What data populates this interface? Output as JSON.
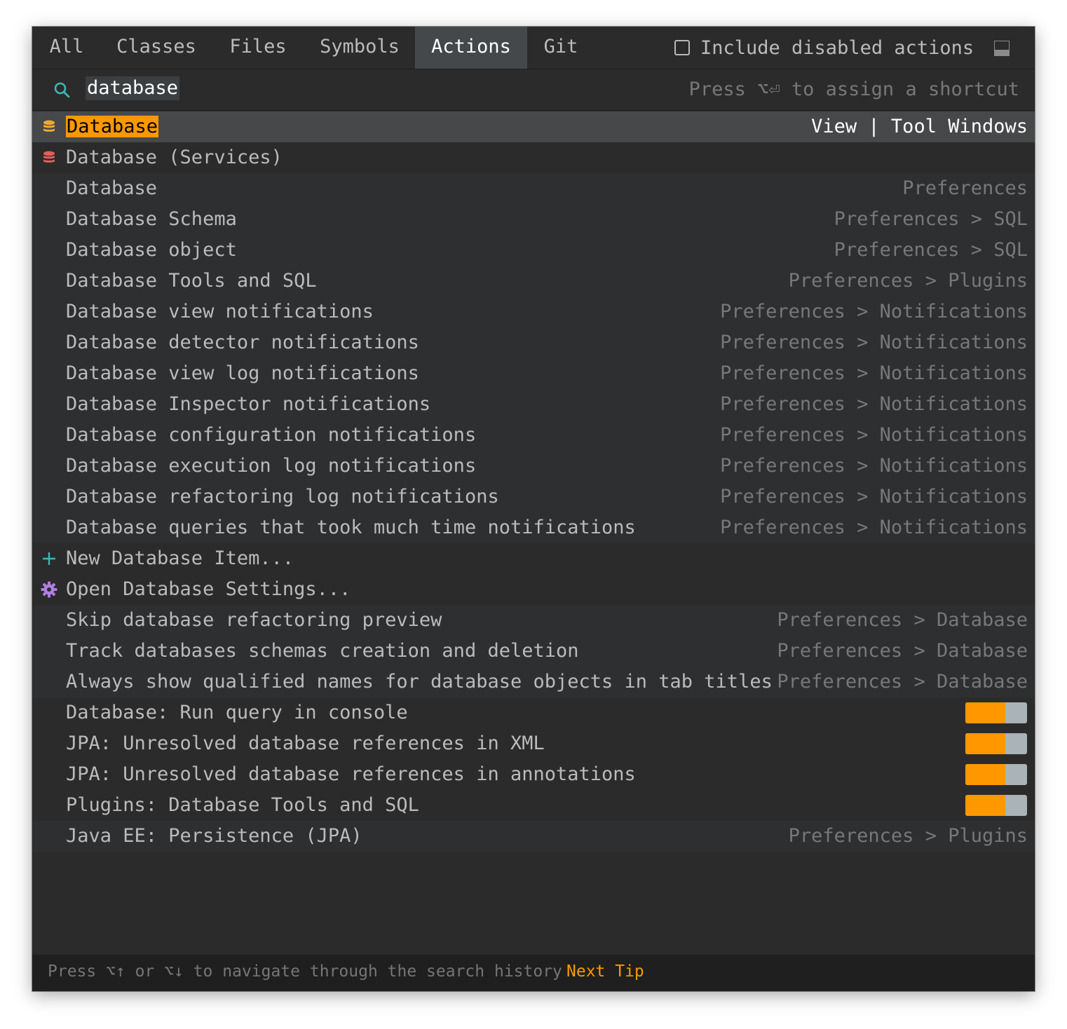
{
  "tabs": [
    {
      "label": "All"
    },
    {
      "label": "Classes"
    },
    {
      "label": "Files"
    },
    {
      "label": "Symbols"
    },
    {
      "label": "Actions",
      "active": true
    },
    {
      "label": "Git"
    }
  ],
  "include_disabled": {
    "label": "Include disabled actions",
    "checked": false
  },
  "search": {
    "value": "database",
    "hint": "Press ⌥⏎ to assign a shortcut"
  },
  "results": {
    "selected": {
      "match": "Database",
      "location": "View | Tool Windows",
      "icon": "database-icon"
    },
    "services": {
      "name": "Database (Services)",
      "icon": "database-services-icon"
    },
    "settings_group": [
      {
        "name": "Database",
        "location": "Preferences"
      },
      {
        "name": "Database Schema",
        "location": "Preferences > SQL"
      },
      {
        "name": "Database object",
        "location": "Preferences > SQL"
      },
      {
        "name": "Database Tools and SQL",
        "location": "Preferences > Plugins"
      },
      {
        "name": "Database view notifications",
        "location": "Preferences > Notifications"
      },
      {
        "name": "Database detector notifications",
        "location": "Preferences > Notifications"
      },
      {
        "name": "Database view log notifications",
        "location": "Preferences > Notifications"
      },
      {
        "name": "Database Inspector notifications",
        "location": "Preferences > Notifications"
      },
      {
        "name": "Database configuration notifications",
        "location": "Preferences > Notifications"
      },
      {
        "name": "Database execution log notifications",
        "location": "Preferences > Notifications"
      },
      {
        "name": "Database refactoring log notifications",
        "location": "Preferences > Notifications"
      },
      {
        "name": "Database queries that took much time notifications",
        "location": "Preferences > Notifications"
      }
    ],
    "actions": [
      {
        "name": "New Database Item...",
        "icon": "plus-icon"
      },
      {
        "name": "Open Database Settings...",
        "icon": "gear-icon"
      }
    ],
    "db_options": [
      {
        "name": "Skip database refactoring preview",
        "location": "Preferences > Database"
      },
      {
        "name": "Track databases schemas creation and deletion",
        "location": "Preferences > Database"
      },
      {
        "name": "Always show qualified names for database objects in tab titles",
        "location": "Preferences > Database"
      }
    ],
    "toggles": [
      {
        "name": "Database: Run query in console",
        "on": true
      },
      {
        "name": "JPA: Unresolved database references in XML",
        "on": true
      },
      {
        "name": "JPA: Unresolved database references in annotations",
        "on": true
      },
      {
        "name": "Plugins: Database Tools and SQL",
        "on": true
      }
    ],
    "last": {
      "name": "Java EE: Persistence (JPA)",
      "location": "Preferences > Plugins"
    }
  },
  "footer": {
    "tip": "Press ⌥↑ or ⌥↓ to navigate through the search history",
    "next_tip": "Next Tip"
  },
  "colors": {
    "accent": "#ff9800",
    "background": "#2b2b2b",
    "selection": "#46484a",
    "toggle_off": "#a9b3b8"
  }
}
